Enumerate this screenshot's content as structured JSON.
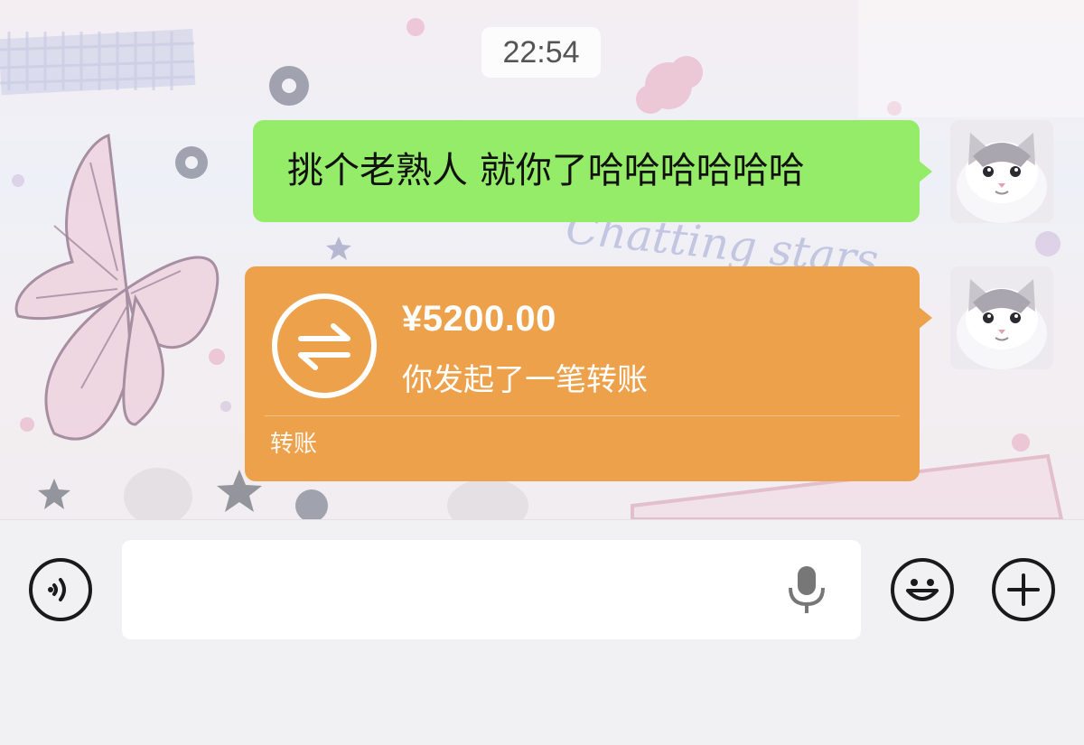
{
  "chat": {
    "timestamp": "22:54",
    "messages": [
      {
        "type": "text",
        "text": "挑个老熟人 就你了哈哈哈哈哈哈",
        "sender": "self"
      },
      {
        "type": "transfer",
        "amount": "¥5200.00",
        "description": "你发起了一笔转账",
        "footer_label": "转账",
        "sender": "self"
      }
    ]
  },
  "wallpaper": {
    "script_text": "Chatting stars"
  },
  "colors": {
    "text_bubble": "#95ec69",
    "transfer_card": "#eda14b",
    "input_background": "#ffffff"
  },
  "input_bar": {
    "value": "",
    "placeholder": "",
    "left_icon": "voice-icon",
    "field_icon": "microphone-icon",
    "right_icons": [
      "emoji-icon",
      "plus-icon"
    ]
  }
}
